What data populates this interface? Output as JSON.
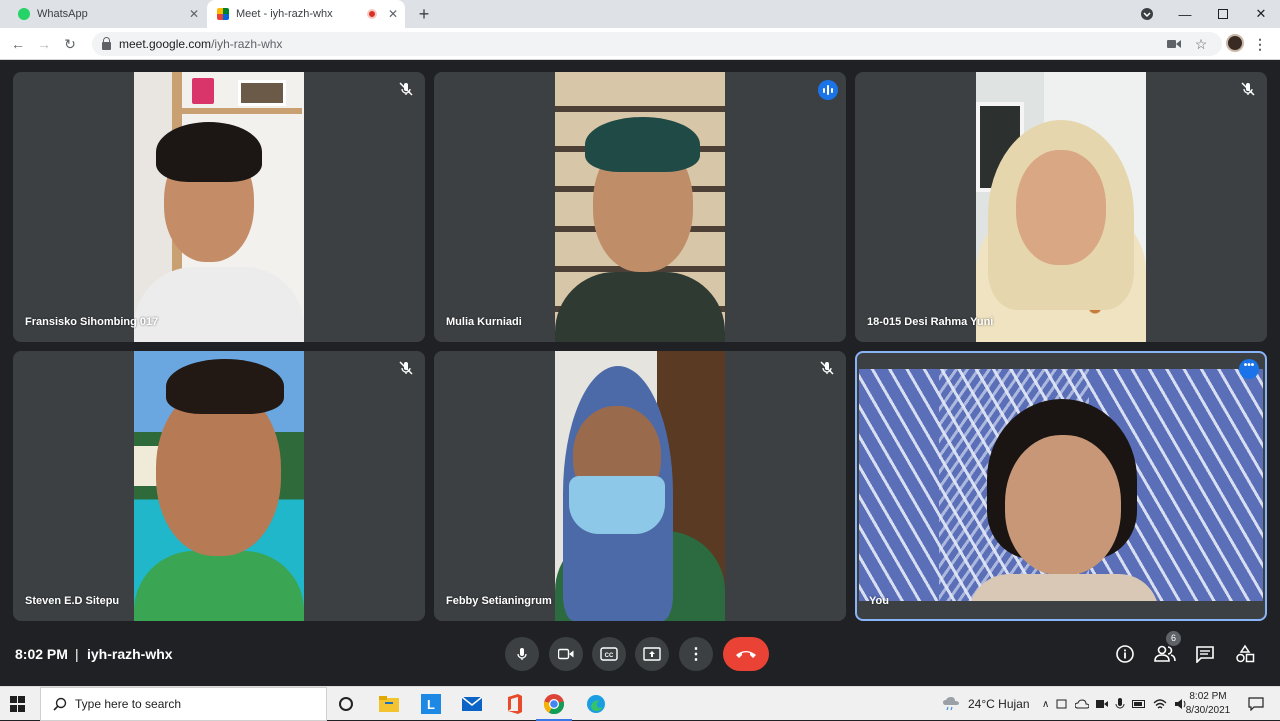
{
  "browser": {
    "tabs": [
      {
        "title": "WhatsApp",
        "favicon": "whatsapp-icon",
        "active": false
      },
      {
        "title": "Meet - iyh-razh-whx",
        "favicon": "google-meet-icon",
        "active": true,
        "recording": true
      }
    ],
    "url_host": "meet.google.com",
    "url_path": "/iyh-razh-whx"
  },
  "participants": [
    {
      "name": "Fransisko Sihombing 017",
      "muted": true
    },
    {
      "name": "Mulia Kurniadi",
      "muted": false,
      "speaking": true
    },
    {
      "name": "18-015 Desi Rahma Yuni",
      "muted": true
    },
    {
      "name": "Steven E.D Sitepu",
      "muted": true
    },
    {
      "name": "Febby Setianingrum",
      "muted": true
    },
    {
      "name": "You",
      "self": true
    }
  ],
  "meeting": {
    "time": "8:02 PM",
    "separator": "|",
    "code": "iyh-razh-whx",
    "participant_count": "6",
    "controls": [
      "microphone",
      "camera",
      "captions",
      "present-screen",
      "more-options",
      "leave-call"
    ],
    "side_controls": [
      "meeting-details",
      "people",
      "chat",
      "activities"
    ]
  },
  "taskbar": {
    "search_placeholder": "Type here to search",
    "pinned": [
      "cortana",
      "file-explorer",
      "word-app",
      "mail",
      "office",
      "chrome",
      "edge"
    ],
    "weather": "24°C  Hujan",
    "clock_time": "8:02 PM",
    "clock_date": "8/30/2021"
  },
  "colors": {
    "meet_background": "#202124",
    "tile_background": "#3c4043",
    "end_call": "#ea4335",
    "speaking": "#1a73e8",
    "self_border": "#8ab4f8"
  }
}
